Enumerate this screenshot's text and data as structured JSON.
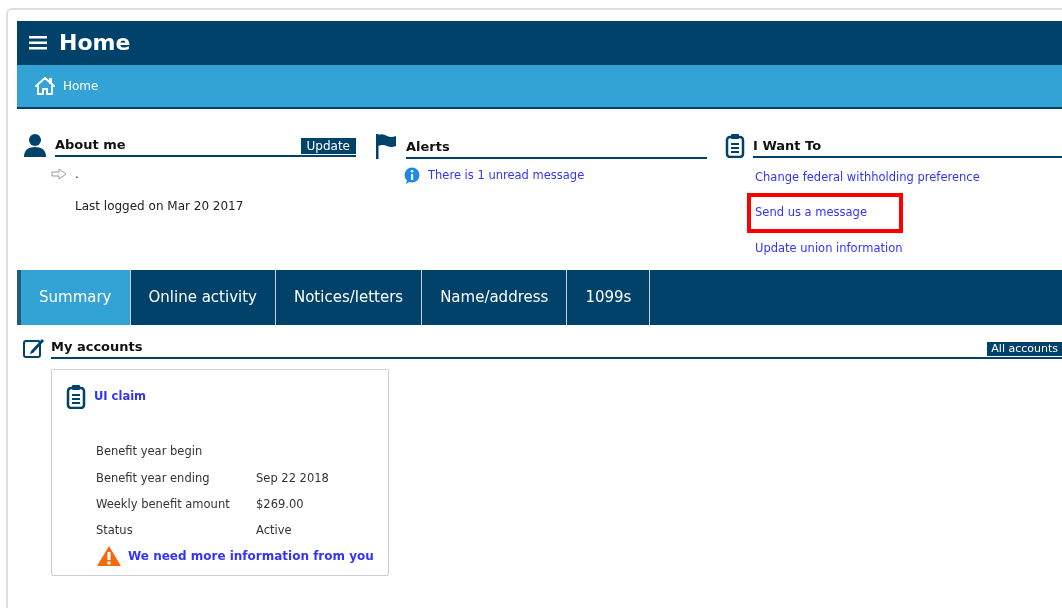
{
  "header": {
    "title": "Home"
  },
  "breadcrumb": [
    {
      "label": "Home"
    }
  ],
  "about_me": {
    "title": "About me",
    "action": "Update",
    "name_line": ".",
    "last_logged": "Last logged on Mar 20 2017"
  },
  "alerts": {
    "title": "Alerts",
    "items": [
      {
        "text": "There is 1 unread message"
      }
    ]
  },
  "i_want_to": {
    "title": "I Want To",
    "links": [
      {
        "label": "Change federal withholding preference",
        "highlighted": false
      },
      {
        "label": "Send us a message",
        "highlighted": true
      },
      {
        "label": "Update union information",
        "highlighted": false
      }
    ]
  },
  "tabs": [
    {
      "label": "Summary",
      "selected": true
    },
    {
      "label": "Online activity",
      "selected": false
    },
    {
      "label": "Notices/letters",
      "selected": false
    },
    {
      "label": "Name/address",
      "selected": false
    },
    {
      "label": "1099s",
      "selected": false
    }
  ],
  "my_accounts": {
    "title": "My accounts",
    "action": "All accounts",
    "cards": [
      {
        "title": "UI claim",
        "fields": [
          {
            "label": "Benefit year begin"
          },
          {
            "label": "Benefit year ending",
            "value": "Sep 22 2018"
          },
          {
            "label": "Weekly benefit amount",
            "value": "$269.00"
          },
          {
            "label": "Status",
            "value": "Active"
          }
        ],
        "warning": "We need more information from you"
      }
    ]
  }
}
